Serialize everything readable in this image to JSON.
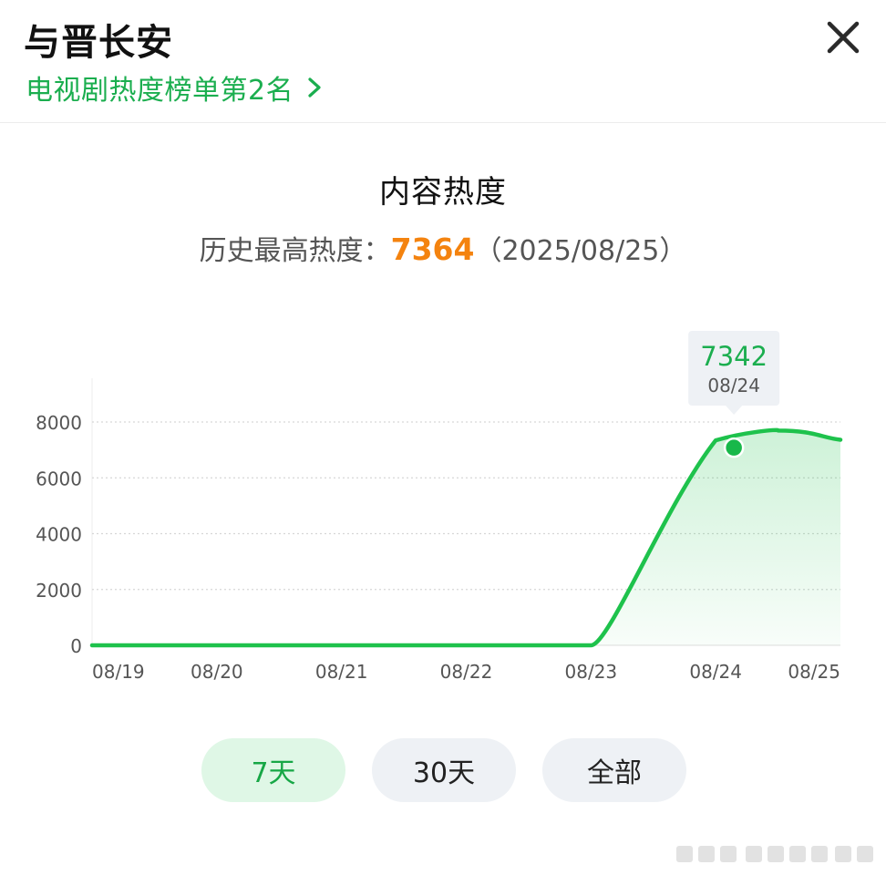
{
  "header": {
    "title": "与晋长安",
    "ranking_link": "电视剧热度榜单第2名"
  },
  "icons": {
    "close": "close-icon",
    "chevron": "chevron-right-icon"
  },
  "section": {
    "title": "内容热度",
    "peak_label": "历史最高热度：",
    "peak_value": "7364",
    "peak_date": "（2025/08/25）"
  },
  "colors": {
    "accent": "#1bae4f",
    "line": "#1ec24c",
    "peak": "#f4830f",
    "tab_active_bg": "#dff7e6"
  },
  "tooltip": {
    "value": "7342",
    "date": "08/24"
  },
  "chart_data": {
    "type": "line",
    "x": [
      "08/19",
      "08/20",
      "08/21",
      "08/22",
      "08/23",
      "08/24",
      "08/25"
    ],
    "series": [
      {
        "values": [
          0,
          0,
          0,
          0,
          0,
          7342,
          7364
        ]
      }
    ],
    "ylim": [
      0,
      8000
    ],
    "yticks": [
      0,
      2000,
      4000,
      6000,
      8000
    ],
    "grid": true,
    "highlight_index": 5
  },
  "tabs": [
    {
      "label": "7天",
      "active": true
    },
    {
      "label": "30天",
      "active": false
    },
    {
      "label": "全部",
      "active": false
    }
  ]
}
